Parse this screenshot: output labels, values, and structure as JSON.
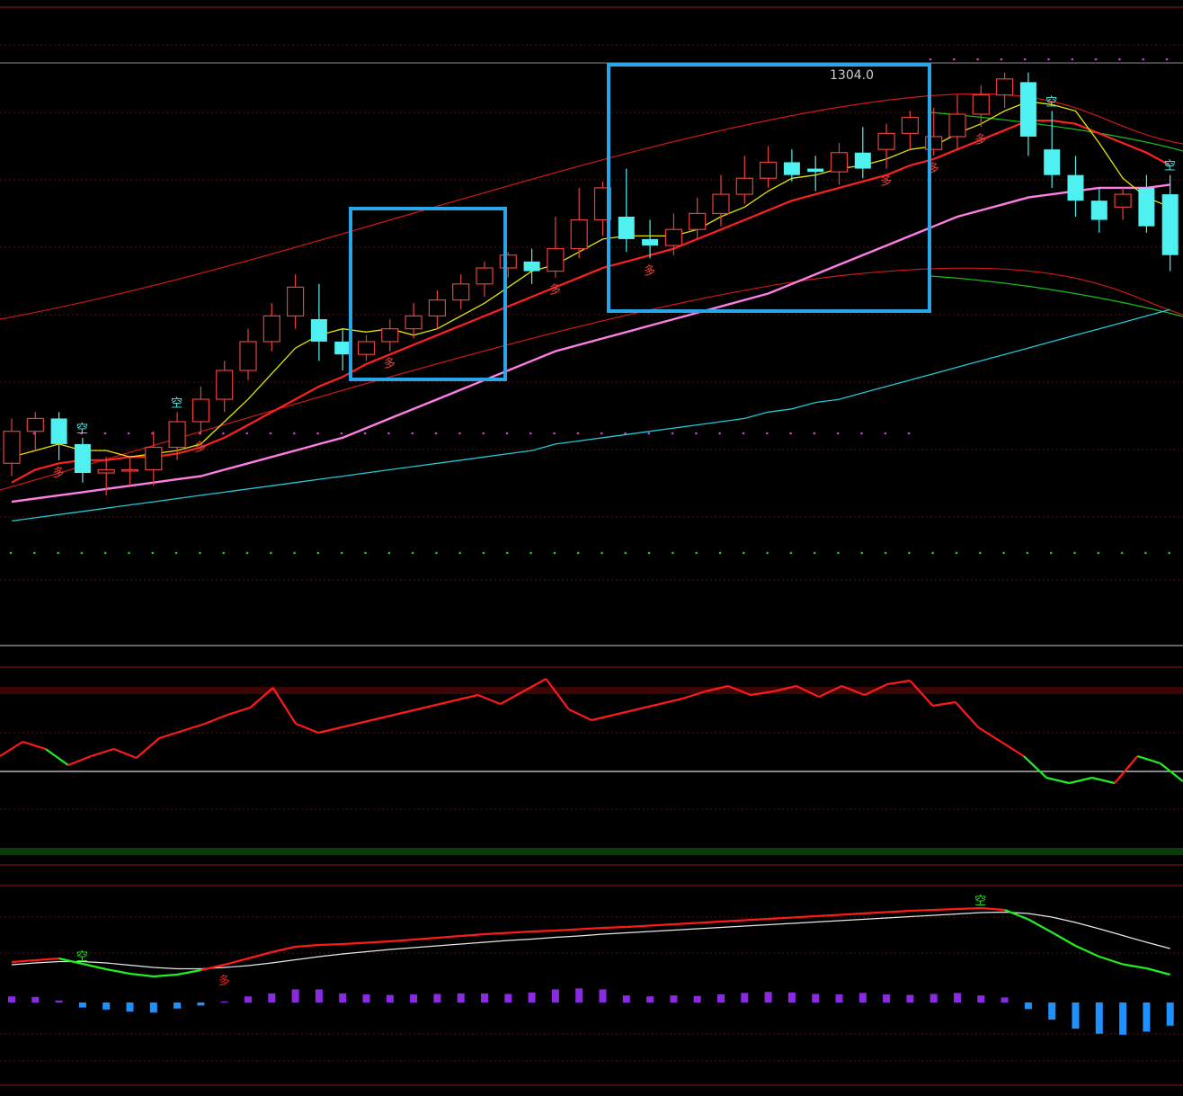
{
  "colors": {
    "background": "#000000",
    "up_candle": "#e8403a",
    "down_candle": "#4ef0f0",
    "ma5": "#e6e600",
    "ma10": "#ff2020",
    "ma20": "#ff7de5",
    "ma60": "#23c7d6",
    "channel_upper": "#d01818",
    "channel_lower": "#d01818",
    "channel_green": "#19c019",
    "highlight_box": "#2aa6e8",
    "rsi_up": "#ff1a1a",
    "rsi_down": "#22ee22",
    "macd_dif_up": "#ff1a1a",
    "macd_dif_down": "#22ee22",
    "macd_dea": "#e8e8e8",
    "macd_bar_pos": "#8a2be2",
    "macd_bar_neg": "#1e90ff",
    "dotted_magenta": "#d040d0",
    "dotted_green": "#22cc22"
  },
  "labels": {
    "peak_price": "1304.0",
    "buy_signal": "多",
    "sell_signal": "空"
  },
  "chart_data": [
    {
      "type": "candlestick",
      "panel": "price",
      "x": [
        1,
        2,
        3,
        4,
        5,
        6,
        7,
        8,
        9,
        10,
        11,
        12,
        13,
        14,
        15,
        16,
        17,
        18,
        19,
        20,
        21,
        22,
        23,
        24,
        25,
        26,
        27,
        28,
        29,
        30,
        31,
        32,
        33,
        34,
        35,
        36,
        37,
        38,
        39,
        40,
        41,
        42,
        43,
        44,
        45,
        46,
        47,
        48,
        49,
        50
      ],
      "open": [
        1220,
        1230,
        1234,
        1226,
        1217,
        1218,
        1218,
        1225,
        1233,
        1240,
        1249,
        1258,
        1266,
        1265,
        1258,
        1254,
        1258,
        1262,
        1266,
        1271,
        1276,
        1281,
        1283,
        1280,
        1287,
        1296,
        1297,
        1290,
        1288,
        1293,
        1298,
        1304,
        1309,
        1314,
        1312,
        1311,
        1317,
        1318,
        1323,
        1318,
        1322,
        1329,
        1335,
        1339,
        1318,
        1310,
        1302,
        1300,
        1306,
        1304
      ],
      "close": [
        1230,
        1234,
        1226,
        1217,
        1218,
        1218,
        1225,
        1233,
        1240,
        1249,
        1258,
        1266,
        1275,
        1258,
        1254,
        1258,
        1262,
        1266,
        1271,
        1276,
        1281,
        1285,
        1280,
        1287,
        1296,
        1306,
        1290,
        1288,
        1293,
        1298,
        1304,
        1309,
        1314,
        1310,
        1311,
        1317,
        1312,
        1323,
        1328,
        1322,
        1329,
        1335,
        1340,
        1322,
        1310,
        1302,
        1296,
        1304,
        1294,
        1285
      ],
      "high": [
        1234,
        1236,
        1236,
        1228,
        1222,
        1222,
        1230,
        1236,
        1244,
        1252,
        1262,
        1270,
        1279,
        1276,
        1262,
        1260,
        1265,
        1270,
        1274,
        1279,
        1283,
        1286,
        1287,
        1297,
        1306,
        1308,
        1312,
        1296,
        1298,
        1303,
        1310,
        1316,
        1319,
        1318,
        1316,
        1320,
        1325,
        1326,
        1330,
        1331,
        1335,
        1338,
        1342,
        1342,
        1330,
        1316,
        1306,
        1306,
        1310,
        1310
      ],
      "low": [
        1216,
        1224,
        1221,
        1214,
        1210,
        1213,
        1213,
        1221,
        1229,
        1236,
        1246,
        1255,
        1262,
        1252,
        1249,
        1252,
        1255,
        1259,
        1262,
        1268,
        1272,
        1278,
        1276,
        1278,
        1284,
        1291,
        1286,
        1284,
        1285,
        1290,
        1294,
        1301,
        1306,
        1308,
        1305,
        1307,
        1309,
        1312,
        1318,
        1316,
        1318,
        1325,
        1331,
        1316,
        1306,
        1297,
        1292,
        1296,
        1292,
        1280
      ],
      "ma5": [
        1222,
        1224,
        1226,
        1224,
        1224,
        1222,
        1223,
        1224,
        1226,
        1233,
        1240,
        1248,
        1256,
        1260,
        1262,
        1261,
        1262,
        1260,
        1262,
        1266,
        1270,
        1275,
        1280,
        1282,
        1286,
        1290,
        1291,
        1291,
        1291,
        1293,
        1297,
        1300,
        1305,
        1309,
        1310,
        1312,
        1313,
        1315,
        1318,
        1319,
        1323,
        1326,
        1330,
        1333,
        1332,
        1330,
        1320,
        1309,
        1303,
        1300
      ],
      "ma10": [
        1214,
        1218,
        1220,
        1221,
        1221,
        1222,
        1222,
        1223,
        1225,
        1228,
        1232,
        1236,
        1240,
        1244,
        1247,
        1251,
        1254,
        1257,
        1260,
        1263,
        1266,
        1269,
        1272,
        1275,
        1278,
        1281,
        1283,
        1285,
        1287,
        1290,
        1293,
        1296,
        1299,
        1302,
        1304,
        1306,
        1308,
        1310,
        1313,
        1315,
        1318,
        1321,
        1324,
        1327,
        1327,
        1326,
        1323,
        1320,
        1317,
        1313
      ],
      "ma20": [
        1208,
        1209,
        1210,
        1211,
        1212,
        1213,
        1214,
        1215,
        1216,
        1218,
        1220,
        1222,
        1224,
        1226,
        1228,
        1231,
        1234,
        1237,
        1240,
        1243,
        1246,
        1249,
        1252,
        1255,
        1257,
        1259,
        1261,
        1263,
        1265,
        1267,
        1269,
        1271,
        1273,
        1276,
        1279,
        1282,
        1285,
        1288,
        1291,
        1294,
        1297,
        1299,
        1301,
        1303,
        1304,
        1305,
        1306,
        1306,
        1306,
        1307
      ],
      "ma60": [
        1202,
        1203,
        1204,
        1205,
        1206,
        1207,
        1208,
        1209,
        1210,
        1211,
        1212,
        1213,
        1214,
        1215,
        1216,
        1217,
        1218,
        1219,
        1220,
        1221,
        1222,
        1223,
        1224,
        1226,
        1227,
        1228,
        1229,
        1230,
        1231,
        1232,
        1233,
        1234,
        1236,
        1237,
        1239,
        1240,
        1242,
        1244,
        1246,
        1248,
        1250,
        1252,
        1254,
        1256,
        1258,
        1260,
        1262,
        1264,
        1266,
        1268
      ],
      "peak": 1304.0,
      "signals_buy_at": [
        2,
        8,
        16,
        23,
        27,
        37,
        39,
        41
      ],
      "signals_sell_at": [
        3,
        7,
        44,
        49
      ]
    },
    {
      "type": "line",
      "panel": "oscillator",
      "x": [
        1,
        2,
        3,
        4,
        5,
        6,
        7,
        8,
        9,
        10,
        11,
        12,
        13,
        14,
        15,
        16,
        17,
        18,
        19,
        20,
        21,
        22,
        23,
        24,
        25,
        26,
        27,
        28,
        29,
        30,
        31,
        32,
        33,
        34,
        35,
        36,
        37,
        38,
        39,
        40,
        41,
        42,
        43,
        44,
        45,
        46,
        47,
        48,
        49,
        50
      ],
      "values": [
        52,
        60,
        56,
        47,
        52,
        56,
        51,
        62,
        66,
        70,
        75,
        79,
        90,
        70,
        65,
        68,
        71,
        74,
        77,
        80,
        83,
        86,
        81,
        88,
        95,
        78,
        72,
        75,
        78,
        81,
        84,
        88,
        91,
        86,
        88,
        91,
        85,
        91,
        86,
        92,
        94,
        80,
        82,
        68,
        60,
        52,
        40,
        37,
        40,
        37,
        52,
        48,
        38
      ]
    },
    {
      "type": "macd",
      "panel": "macd",
      "x": [
        1,
        2,
        3,
        4,
        5,
        6,
        7,
        8,
        9,
        10,
        11,
        12,
        13,
        14,
        15,
        16,
        17,
        18,
        19,
        20,
        21,
        22,
        23,
        24,
        25,
        26,
        27,
        28,
        29,
        30,
        31,
        32,
        33,
        34,
        35,
        36,
        37,
        38,
        39,
        40,
        41,
        42,
        43,
        44,
        45,
        46,
        47,
        48,
        49,
        50
      ],
      "dif": [
        2.0,
        2.4,
        2.8,
        1.6,
        0.4,
        -0.6,
        -1.2,
        -0.8,
        0.2,
        1.4,
        2.8,
        4.2,
        5.4,
        5.8,
        6.0,
        6.3,
        6.6,
        7.0,
        7.4,
        7.8,
        8.2,
        8.5,
        8.8,
        9.0,
        9.3,
        9.6,
        9.8,
        10.1,
        10.4,
        10.7,
        11.0,
        11.3,
        11.6,
        11.9,
        12.2,
        12.5,
        12.8,
        13.1,
        13.4,
        13.6,
        13.8,
        14.0,
        13.6,
        11.5,
        8.6,
        5.6,
        3.2,
        1.5,
        0.6,
        -0.8
      ],
      "dea": [
        1.4,
        1.8,
        2.1,
        2.1,
        1.8,
        1.3,
        0.8,
        0.5,
        0.5,
        0.8,
        1.2,
        1.8,
        2.5,
        3.2,
        3.8,
        4.3,
        4.8,
        5.2,
        5.6,
        6.0,
        6.4,
        6.8,
        7.1,
        7.5,
        7.8,
        8.2,
        8.5,
        8.8,
        9.1,
        9.4,
        9.7,
        10.0,
        10.3,
        10.6,
        10.9,
        11.2,
        11.5,
        11.8,
        12.1,
        12.4,
        12.7,
        13.0,
        13.1,
        12.8,
        12.0,
        10.8,
        9.4,
        7.9,
        6.4,
        5.0
      ],
      "histogram": [
        1.2,
        1.1,
        0.4,
        -1.0,
        -1.4,
        -1.8,
        -2.0,
        -1.2,
        -0.6,
        0.2,
        1.2,
        1.8,
        2.6,
        2.6,
        1.8,
        1.6,
        1.5,
        1.6,
        1.7,
        1.8,
        1.8,
        1.7,
        2.0,
        2.6,
        2.8,
        2.6,
        1.4,
        1.2,
        1.4,
        1.3,
        1.6,
        1.9,
        2.1,
        2.0,
        1.7,
        1.6,
        1.9,
        1.6,
        1.5,
        1.7,
        1.9,
        1.4,
        1.0,
        -1.3,
        -3.4,
        -5.2,
        -6.2,
        -6.4,
        -5.8,
        -4.6
      ]
    }
  ]
}
